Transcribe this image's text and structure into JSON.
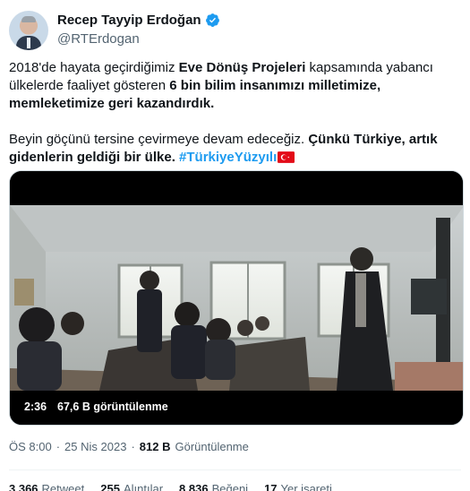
{
  "author": {
    "name": "Recep Tayyip Erdoğan",
    "handle": "@RTErdogan"
  },
  "tweet": {
    "p1_a": "2018'de hayata geçirdiğimiz ",
    "p1_b": "Eve Dönüş Projeleri",
    "p1_c": " kapsamında yabancı ülkelerde faaliyet gösteren ",
    "p1_d": "6 bin bilim insanımızı milletimize, memleketimize geri kazandırdık.",
    "p2_a": "Beyin göçünü tersine çevirmeye devam edeceğiz. ",
    "p2_b": "Çünkü Türkiye, artık gidenlerin geldiği bir ülke.",
    "hashtag": "#TürkiyeYüzyılı"
  },
  "video": {
    "duration": "2:36",
    "views": "67,6 B görüntülenme"
  },
  "meta": {
    "time": "ÖS 8:00",
    "sep": "·",
    "date": "25 Nis 2023",
    "views_count": "812 B",
    "views_label": "Görüntülenme"
  },
  "stats": [
    {
      "num": "3.366",
      "label": "Retweet"
    },
    {
      "num": "255",
      "label": "Alıntılar"
    },
    {
      "num": "8.836",
      "label": "Beğeni"
    },
    {
      "num": "17",
      "label": "Yer işareti"
    }
  ],
  "colors": {
    "text": "#0f1419",
    "secondary": "#536471",
    "link": "#1d9bf0",
    "verified": "#1d9bf0",
    "flag_red": "#e30a17"
  }
}
